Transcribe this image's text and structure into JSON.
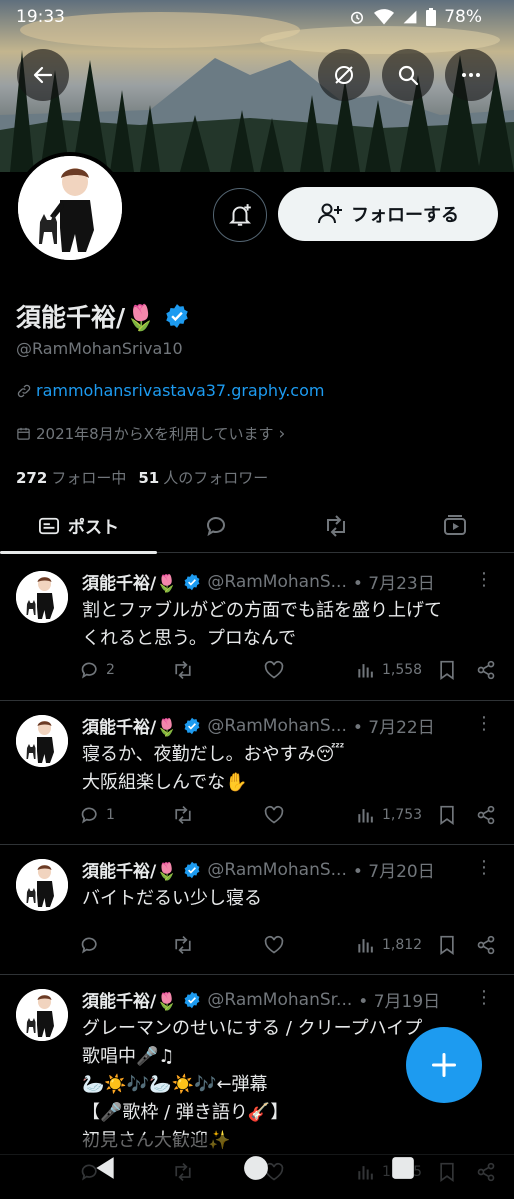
{
  "status_bar": {
    "time": "19:33",
    "battery": "78%"
  },
  "profile": {
    "name": "須能千裕/🌷",
    "handle": "@RamMohanSriva10",
    "link": "rammohansrivastava37.graphy.com",
    "joined": "2021年8月からXを利用しています",
    "following_count": "272",
    "following_label": "フォロー中",
    "followers_count": "51",
    "followers_label": "人のフォロワー",
    "follow_button": "フォローする"
  },
  "tabs": {
    "posts": "ポスト"
  },
  "tweets": [
    {
      "name": "須能千裕/🌷",
      "handle": "@RamMohanS...",
      "date": "• 7月23日",
      "text": "割とファブルがどの方面でも話を盛り上げて\nくれると思う。プロなんで",
      "replies": "2",
      "views": "1,558"
    },
    {
      "name": "須能千裕/🌷",
      "handle": "@RamMohanS...",
      "date": "• 7月22日",
      "text": "寝るか、夜勤だし。おやすみ😴\n大阪組楽しんでな✋",
      "replies": "1",
      "views": "1,753"
    },
    {
      "name": "須能千裕/🌷",
      "handle": "@RamMohanS...",
      "date": "• 7月20日",
      "text": "バイトだるい少し寝る",
      "replies": "",
      "views": "1,812"
    },
    {
      "name": "須能千裕/🌷",
      "handle": "@RamMohanSr...",
      "date": "• 7月19日",
      "text": "グレーマンのせいにする / クリープハイプ\n歌唱中🎤♫\n🦢☀️🎶🦢☀️🎶←弾幕\n【🎤歌枠 / 弾き語り🎸】\n初見さん大歓迎✨",
      "replies": "",
      "views": "1,485"
    }
  ],
  "colors": {
    "accent": "#1d9bf0",
    "background": "#000000",
    "muted": "#71767b"
  }
}
